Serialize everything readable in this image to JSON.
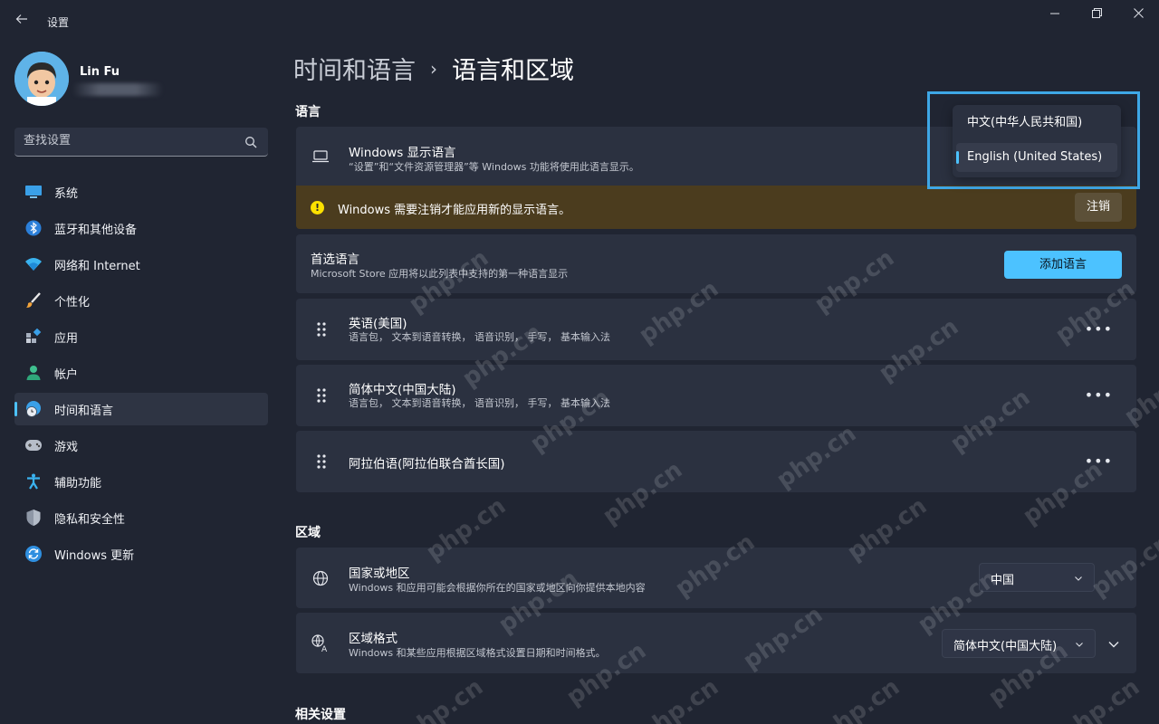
{
  "titlebar": {
    "back_icon": "back-arrow-icon",
    "app_title": "设置",
    "minimize_icon": "minimize-icon",
    "restore_icon": "restore-icon",
    "close_icon": "close-icon"
  },
  "user": {
    "name": "Lin Fu"
  },
  "search": {
    "placeholder": "查找设置",
    "icon": "search-icon"
  },
  "sidebar": {
    "items": [
      {
        "label": "系统",
        "icon": "monitor-icon",
        "active": false
      },
      {
        "label": "蓝牙和其他设备",
        "icon": "bluetooth-icon",
        "active": false
      },
      {
        "label": "网络和 Internet",
        "icon": "wifi-icon",
        "active": false
      },
      {
        "label": "个性化",
        "icon": "brush-icon",
        "active": false
      },
      {
        "label": "应用",
        "icon": "apps-icon",
        "active": false
      },
      {
        "label": "帐户",
        "icon": "person-icon",
        "active": false
      },
      {
        "label": "时间和语言",
        "icon": "globe-clock-icon",
        "active": true
      },
      {
        "label": "游戏",
        "icon": "gamepad-icon",
        "active": false
      },
      {
        "label": "辅助功能",
        "icon": "accessibility-icon",
        "active": false
      },
      {
        "label": "隐私和安全性",
        "icon": "shield-icon",
        "active": false
      },
      {
        "label": "Windows 更新",
        "icon": "update-icon",
        "active": false
      }
    ]
  },
  "breadcrumb": {
    "parent": "时间和语言",
    "separator": "›",
    "current": "语言和区域"
  },
  "language_section": {
    "title": "语言",
    "display_language": {
      "title": "Windows 显示语言",
      "desc": "“设置”和“文件资源管理器”等 Windows 功能将使用此语言显示。",
      "icon": "laptop-icon"
    },
    "warning": {
      "text": "Windows 需要注销才能应用新的显示语言。",
      "button": "注销",
      "icon": "warning-icon"
    },
    "preferred": {
      "title": "首选语言",
      "desc": "Microsoft Store 应用将以此列表中支持的第一种语言显示",
      "button": "添加语言"
    },
    "languages": [
      {
        "name": "英语(美国)",
        "features": "语言包， 文本到语音转换， 语音识别， 手写， 基本输入法"
      },
      {
        "name": "简体中文(中国大陆)",
        "features": "语言包， 文本到语音转换， 语音识别， 手写， 基本输入法"
      },
      {
        "name": "阿拉伯语(阿拉伯联合酋长国)",
        "features": ""
      }
    ],
    "more_label": "•••"
  },
  "region_section": {
    "title": "区域",
    "country": {
      "title": "国家或地区",
      "desc": "Windows 和应用可能会根据你所在的国家或地区向你提供本地内容",
      "value": "中国",
      "icon": "globe-icon"
    },
    "format": {
      "title": "区域格式",
      "desc": "Windows 和某些应用根据区域格式设置日期和时间格式。",
      "value": "简体中文(中国大陆)",
      "icon": "regional-format-icon"
    }
  },
  "related_section": {
    "title": "相关设置"
  },
  "display_language_popup": {
    "options": [
      "中文(中华人民共和国)",
      "English (United States)"
    ],
    "selected": "English (United States)"
  },
  "watermark": "php.cn",
  "colors": {
    "accent": "#4cc2ff",
    "warning_bg": "#4b3c1e",
    "card_bg": "#2b3140",
    "page_bg": "#202532"
  }
}
